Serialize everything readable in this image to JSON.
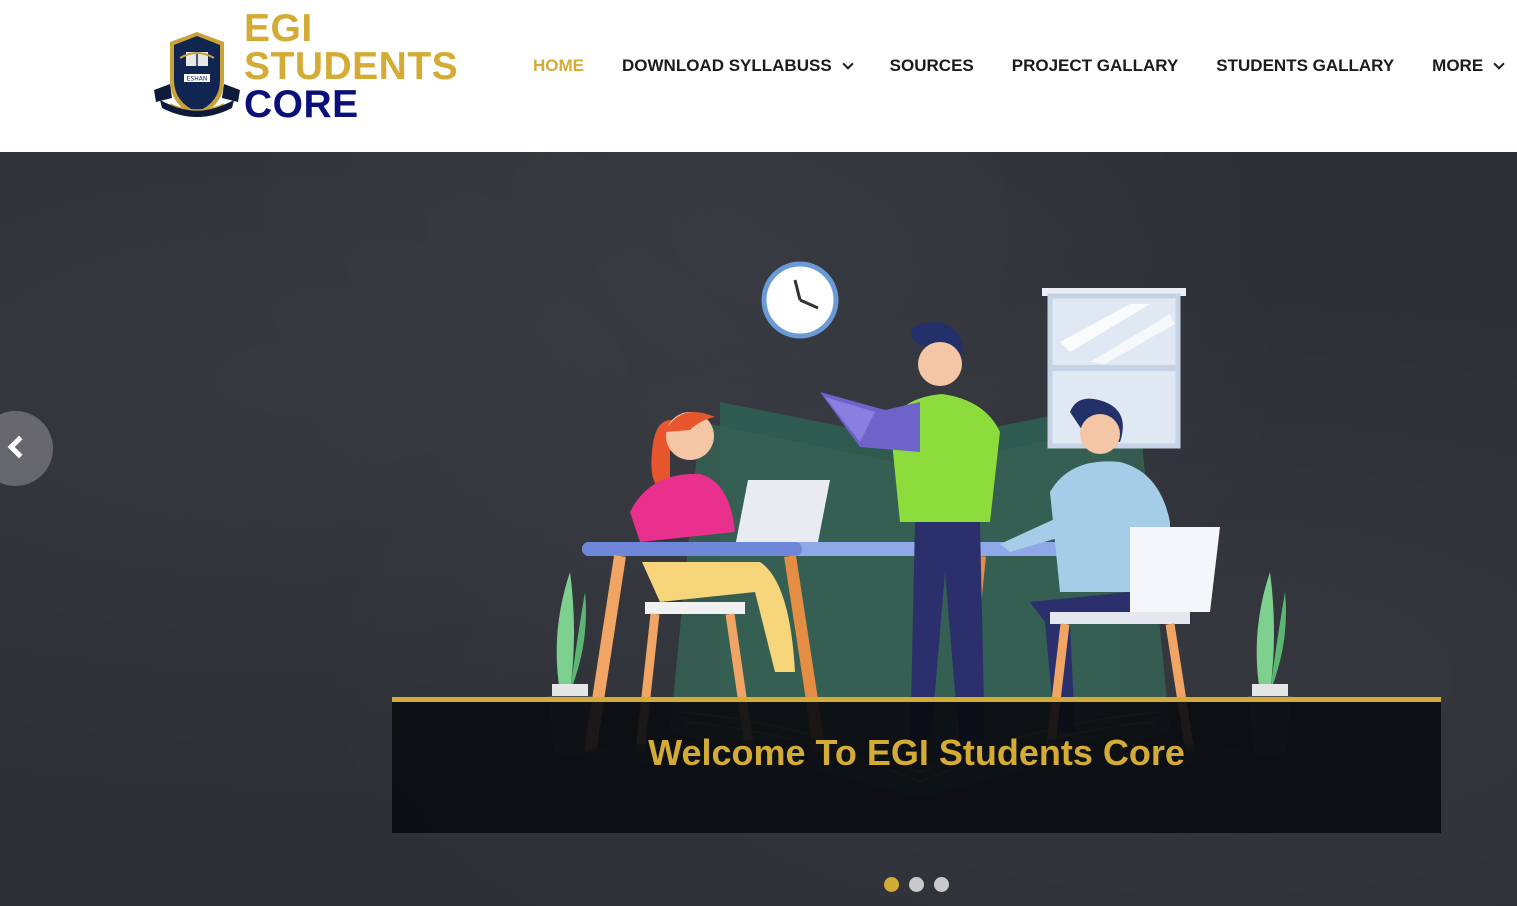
{
  "logo": {
    "line1": "EGI",
    "line2": "STUDENTS",
    "line3": "CORE",
    "crest_text": "ESHAN",
    "icon": "college-crest-icon"
  },
  "nav": {
    "items": [
      {
        "label": "HOME",
        "active": true,
        "dropdown": false
      },
      {
        "label": "DOWNLOAD SYLLABUSS",
        "active": false,
        "dropdown": true
      },
      {
        "label": "SOURCES",
        "active": false,
        "dropdown": false
      },
      {
        "label": "PROJECT GALLARY",
        "active": false,
        "dropdown": false
      },
      {
        "label": "STUDENTS GALLARY",
        "active": false,
        "dropdown": false
      },
      {
        "label": "MORE",
        "active": false,
        "dropdown": true
      }
    ]
  },
  "hero": {
    "caption": "Welcome To EGI Students Core",
    "prev_icon": "chevron-left-icon",
    "slides": 3,
    "active_slide": 1
  },
  "colors": {
    "gold": "#d4ac35",
    "navy": "#0a0f7a",
    "hero_bg": "#2e3038"
  }
}
